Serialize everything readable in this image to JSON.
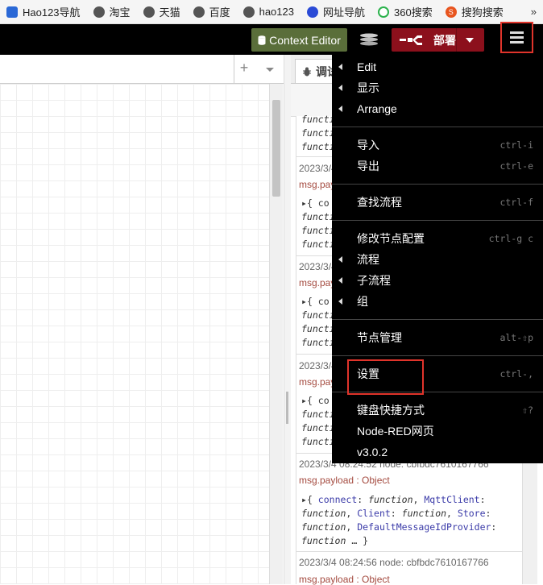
{
  "bookmarks": {
    "items": [
      {
        "label": "Hao123导航",
        "icon": "blue-dot-icon",
        "color": "#2a68d6"
      },
      {
        "label": "淘宝",
        "icon": "globe-icon",
        "color": "#555555"
      },
      {
        "label": "天猫",
        "icon": "globe-icon",
        "color": "#555555"
      },
      {
        "label": "百度",
        "icon": "globe-icon",
        "color": "#555555"
      },
      {
        "label": "hao123",
        "icon": "globe-icon",
        "color": "#555555"
      },
      {
        "label": "网址导航",
        "icon": "paw-icon",
        "color": "#2a4ad6"
      },
      {
        "label": "360搜索",
        "icon": "360-icon",
        "color": "#2bb24c"
      },
      {
        "label": "搜狗搜索",
        "icon": "sogou-icon",
        "color": "#e8551f"
      }
    ],
    "more": "»"
  },
  "header": {
    "context_editor": "Context Editor",
    "deploy": "部署",
    "deploy_color": "#8c101c",
    "context_color": "#5a6e3a"
  },
  "sidebar": {
    "tab_label": "调试",
    "messages": [
      {
        "meta": "2023/3/4",
        "topic": "msg.payl"
      },
      {
        "meta": "2023/3/4",
        "topic": "msg.payl"
      },
      {
        "meta": "2023/3/4",
        "topic": "msg.payl"
      },
      {
        "meta": "2023/3/4 08:24:52   node: cbfbdc7610167766",
        "topic": "msg.payload : Object"
      },
      {
        "meta": "2023/3/4 08:24:56   node: cbfbdc7610167766",
        "topic": "msg.payload : Object"
      }
    ],
    "code_fragment": "function",
    "obj_open": "{ co",
    "full_code": {
      "open": "{ ",
      "connect": "connect",
      "mqtt": "MqttClient",
      "client": "Client",
      "store": "Store",
      "default": "DefaultMessageIdProvider",
      "fn": "function",
      "ellipsis": "… }"
    }
  },
  "menu": {
    "items": [
      {
        "label": "Edit",
        "submenu": true,
        "shortcut": ""
      },
      {
        "label": "显示",
        "submenu": true,
        "shortcut": ""
      },
      {
        "label": "Arrange",
        "submenu": true,
        "shortcut": ""
      },
      {
        "label": "导入",
        "submenu": false,
        "shortcut": "ctrl-i"
      },
      {
        "label": "导出",
        "submenu": false,
        "shortcut": "ctrl-e"
      },
      {
        "label": "查找流程",
        "submenu": false,
        "shortcut": "ctrl-f"
      },
      {
        "label": "修改节点配置",
        "submenu": false,
        "shortcut": "ctrl-g c"
      },
      {
        "label": "流程",
        "submenu": true,
        "shortcut": ""
      },
      {
        "label": "子流程",
        "submenu": true,
        "shortcut": ""
      },
      {
        "label": "组",
        "submenu": true,
        "shortcut": ""
      },
      {
        "label": "节点管理",
        "submenu": false,
        "shortcut": "alt-⇧p"
      },
      {
        "label": "设置",
        "submenu": false,
        "shortcut": "ctrl-,"
      },
      {
        "label": "键盘快捷方式",
        "submenu": false,
        "shortcut": "⇧?"
      },
      {
        "label": "Node-RED网页",
        "submenu": false,
        "shortcut": ""
      },
      {
        "label": "v3.0.2",
        "submenu": false,
        "shortcut": ""
      }
    ]
  }
}
